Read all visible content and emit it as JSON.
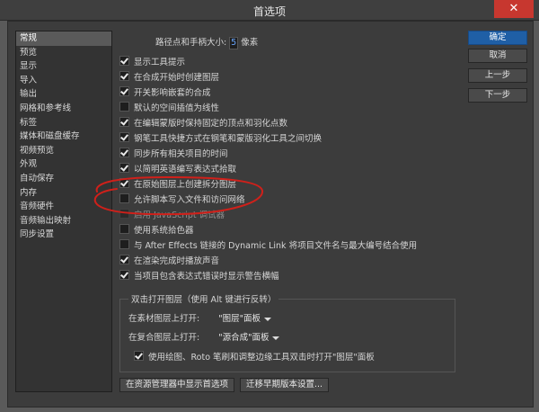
{
  "window": {
    "title": "首选项",
    "close_label": "✕"
  },
  "sidebar": {
    "items": [
      {
        "label": "常规"
      },
      {
        "label": "预览"
      },
      {
        "label": "显示"
      },
      {
        "label": "导入"
      },
      {
        "label": "输出"
      },
      {
        "label": "网格和参考线"
      },
      {
        "label": "标签"
      },
      {
        "label": "媒体和磁盘缓存"
      },
      {
        "label": "视频预览"
      },
      {
        "label": "外观"
      },
      {
        "label": "自动保存"
      },
      {
        "label": "内存"
      },
      {
        "label": "音频硬件"
      },
      {
        "label": "音频输出映射"
      },
      {
        "label": "同步设置"
      }
    ]
  },
  "general": {
    "path_point_label": "路径点和手柄大小:",
    "path_point_value": "5",
    "path_point_unit": "像素",
    "options": [
      {
        "label": "显示工具提示",
        "checked": true,
        "disabled": false
      },
      {
        "label": "在合成开始时创建图层",
        "checked": true,
        "disabled": false
      },
      {
        "label": "开关影响嵌套的合成",
        "checked": true,
        "disabled": false
      },
      {
        "label": "默认的空间插值为线性",
        "checked": false,
        "disabled": false
      },
      {
        "label": "在编辑蒙版时保持固定的顶点和羽化点数",
        "checked": true,
        "disabled": false
      },
      {
        "label": "钢笔工具快捷方式在钢笔和蒙版羽化工具之间切换",
        "checked": true,
        "disabled": false
      },
      {
        "label": "同步所有相关项目的时间",
        "checked": true,
        "disabled": false
      },
      {
        "label": "以简明英语编写表达式拾取",
        "checked": true,
        "disabled": false
      },
      {
        "label": "在原始图层上创建拆分图层",
        "checked": true,
        "disabled": false
      },
      {
        "label": "允许脚本写入文件和访问网络",
        "checked": false,
        "disabled": false
      },
      {
        "label": "启用 JavaScript 调试器",
        "checked": false,
        "disabled": true
      },
      {
        "label": "使用系统拾色器",
        "checked": false,
        "disabled": false
      },
      {
        "label": "与 After Effects 链接的 Dynamic Link 将项目文件名与最大编号结合使用",
        "checked": false,
        "disabled": false
      },
      {
        "label": "在渲染完成时播放声音",
        "checked": true,
        "disabled": false
      },
      {
        "label": "当项目包含表达式错误时显示警告横幅",
        "checked": true,
        "disabled": false
      }
    ],
    "double_click_group_label": "双击打开图层（使用 Alt 键进行反转）",
    "footage_label": "在素材图层上打开:",
    "footage_value": "\"图层\"面板",
    "comp_label": "在复合图层上打开:",
    "comp_value": "\"源合成\"面板",
    "paint_option_label": "使用绘图、Roto 笔刷和调整边缘工具双击时打开\"图层\"面板",
    "paint_option_checked": true
  },
  "buttons": {
    "ok": "确定",
    "cancel": "取消",
    "previous": "上一步",
    "next": "下一步",
    "reveal": "在资源管理器中显示首选项",
    "migrate": "迁移早期版本设置..."
  },
  "colors": {
    "primary_button": "#1f5fa6",
    "annotation": "#d0201a"
  }
}
